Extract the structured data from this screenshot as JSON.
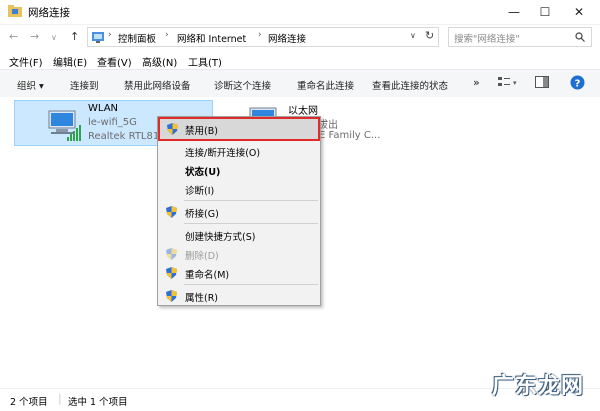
{
  "window": {
    "title": "网络连接",
    "min_icon": "minimize-icon",
    "max_icon": "maximize-icon",
    "close_icon": "close-icon"
  },
  "address": {
    "crumbs": [
      "控制面板",
      "网络和 Internet",
      "网络连接"
    ],
    "search_placeholder": "搜索\"网络连接\""
  },
  "menu": [
    "文件(F)",
    "编辑(E)",
    "查看(V)",
    "高级(N)",
    "工具(T)"
  ],
  "toolbar": {
    "organize": "组织 ▾",
    "items": [
      "连接到",
      "禁用此网络设备",
      "诊断这个连接",
      "重命名此连接",
      "查看此连接的状态"
    ],
    "more": "»"
  },
  "connections": [
    {
      "name": "WLAN",
      "line2": "le-wifi_5G",
      "line3": "Realtek RTL81"
    },
    {
      "name": "以太网",
      "line2": "电缆被拔出",
      "line3": "PCIe FE Family C..."
    }
  ],
  "context_menu": [
    {
      "label": "禁用(B)",
      "shield": true,
      "bold": false,
      "disabled": false
    },
    {
      "label": "连接/断开连接(O)",
      "shield": false,
      "bold": false,
      "disabled": false
    },
    {
      "label": "状态(U)",
      "shield": false,
      "bold": true,
      "disabled": false
    },
    {
      "label": "诊断(I)",
      "shield": false,
      "bold": false,
      "disabled": false
    },
    {
      "label": "桥接(G)",
      "shield": true,
      "bold": false,
      "disabled": false
    },
    {
      "label": "创建快捷方式(S)",
      "shield": false,
      "bold": false,
      "disabled": false
    },
    {
      "label": "删除(D)",
      "shield": true,
      "bold": false,
      "disabled": true
    },
    {
      "label": "重命名(M)",
      "shield": true,
      "bold": false,
      "disabled": false
    },
    {
      "label": "属性(R)",
      "shield": true,
      "bold": false,
      "disabled": false
    }
  ],
  "status": {
    "count": "2 个项目",
    "selected": "选中 1 个项目"
  },
  "watermark": "广东龙网",
  "colors": {
    "selection": "#cce8ff",
    "highlight_border": "#e02b2b",
    "help": "#1e6fd0",
    "shield_blue": "#2f6fd6",
    "shield_yellow": "#f2c230"
  }
}
